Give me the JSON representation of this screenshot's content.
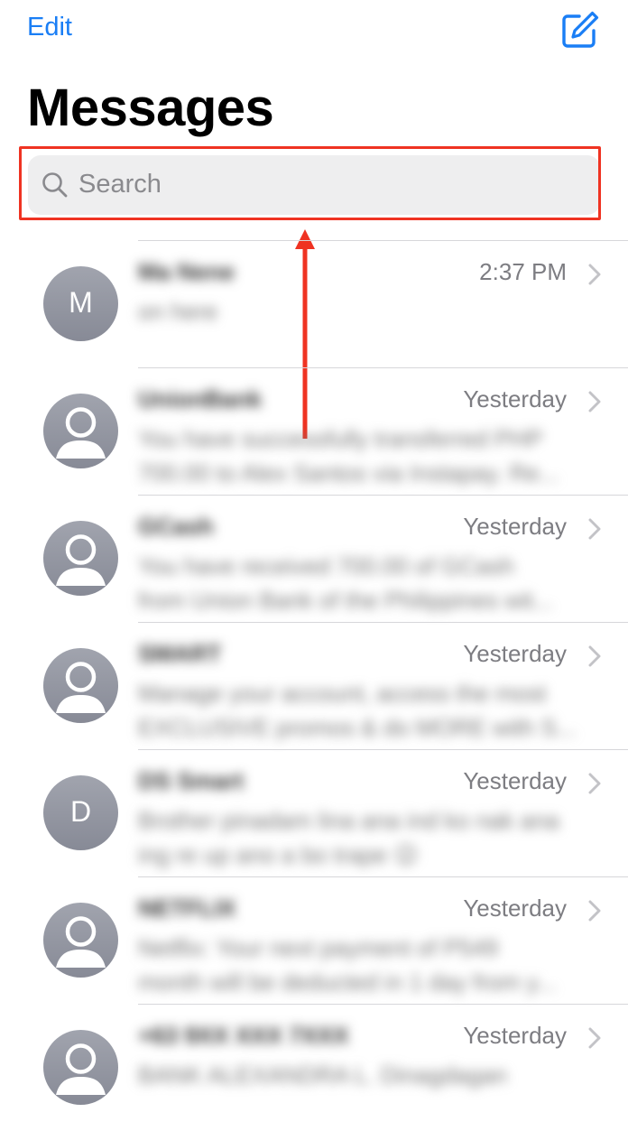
{
  "header": {
    "edit_label": "Edit",
    "title": "Messages"
  },
  "search": {
    "placeholder": "Search"
  },
  "colors": {
    "accent": "#1a7ef5",
    "highlight": "#ef3322"
  },
  "conversations": [
    {
      "initial": "M",
      "name": "Ma Nene",
      "time": "2:37 PM",
      "preview": [
        "on here",
        ""
      ]
    },
    {
      "initial": "",
      "name": "UnionBank",
      "time": "Yesterday",
      "preview": [
        "You have successfully transferred PHP",
        "700.00 to Alex Santos via Instapay. Re..."
      ]
    },
    {
      "initial": "",
      "name": "GCash",
      "time": "Yesterday",
      "preview": [
        "You have received 700.00 of GCash",
        "from Union Bank of the Philippines wit..."
      ]
    },
    {
      "initial": "",
      "name": "SMART",
      "time": "Yesterday",
      "preview": [
        "Manage your account, access the most",
        "EXCLUSIVE promos & do MORE with S..."
      ]
    },
    {
      "initial": "D",
      "name": "DS Smart",
      "time": "Yesterday",
      "preview": [
        "Brother pinadam lina ana ind ko nak ana",
        "ing re up ano a bo trape 😉"
      ]
    },
    {
      "initial": "",
      "name": "NETFLIX",
      "time": "Yesterday",
      "preview": [
        "Netflix: Your next payment of P549",
        "month will be deducted in 1 day from y..."
      ]
    },
    {
      "initial": "",
      "name": "+63 9XX XXX 7XXX",
      "time": "Yesterday",
      "preview": [
        "BANK ALEXANDRA L. Dinagdagan",
        ""
      ]
    }
  ]
}
